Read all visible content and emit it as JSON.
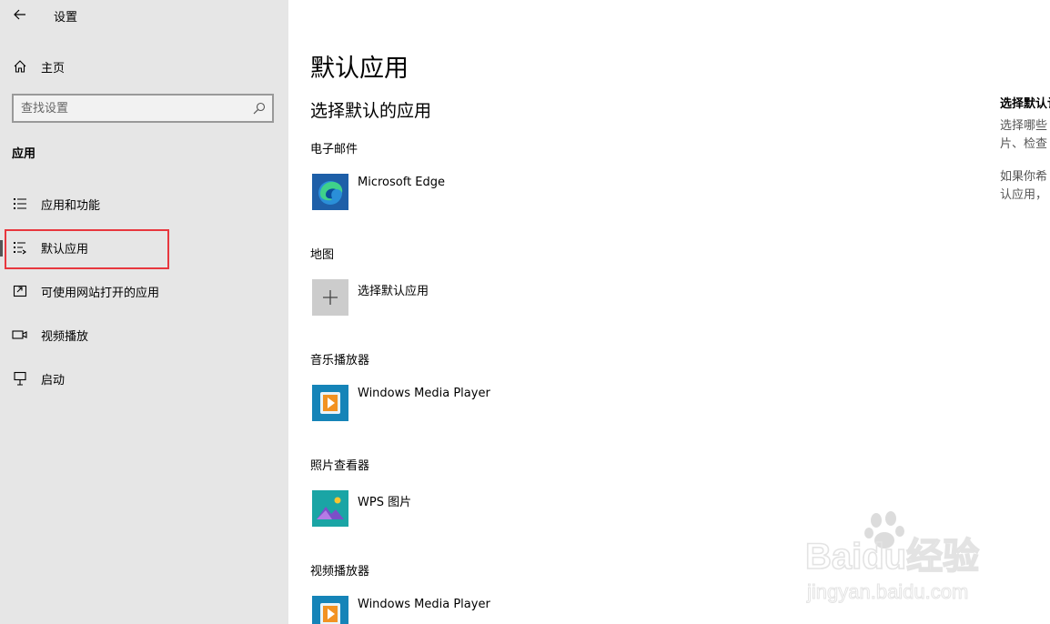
{
  "window": {
    "title": "设置"
  },
  "sidebar": {
    "home_label": "主页",
    "search_placeholder": "查找设置",
    "section_header": "应用",
    "items": [
      {
        "label": "应用和功能",
        "icon": "apps-features-icon"
      },
      {
        "label": "默认应用",
        "icon": "default-apps-icon",
        "selected": true
      },
      {
        "label": "可使用网站打开的应用",
        "icon": "apps-websites-icon"
      },
      {
        "label": "视频播放",
        "icon": "video-playback-icon"
      },
      {
        "label": "启动",
        "icon": "startup-icon"
      }
    ]
  },
  "main": {
    "title": "默认应用",
    "subtitle": "选择默认的应用",
    "categories": [
      {
        "label": "电子邮件",
        "app": "Microsoft Edge",
        "icon": "microsoft-edge-icon"
      },
      {
        "label": "地图",
        "app": "选择默认应用",
        "icon": "plus-icon"
      },
      {
        "label": "音乐播放器",
        "app": "Windows Media Player",
        "icon": "windows-media-player-icon"
      },
      {
        "label": "照片查看器",
        "app": "WPS 图片",
        "icon": "wps-picture-icon"
      },
      {
        "label": "视频播放器",
        "app": "Windows Media Player",
        "icon": "windows-media-player-icon"
      }
    ]
  },
  "related": {
    "title": "选择默认认",
    "para1_line1": "选择哪些",
    "para1_line2": "片、检查",
    "para2_line1": "如果你希",
    "para2_line2": "认应用，"
  },
  "watermark": {
    "brand": "Baidu经验",
    "url": "jingyan.baidu.com"
  },
  "colors": {
    "sidebar_bg": "#e6e6e6",
    "selection_outline": "#e8373e",
    "main_bg": "#ffffff"
  }
}
